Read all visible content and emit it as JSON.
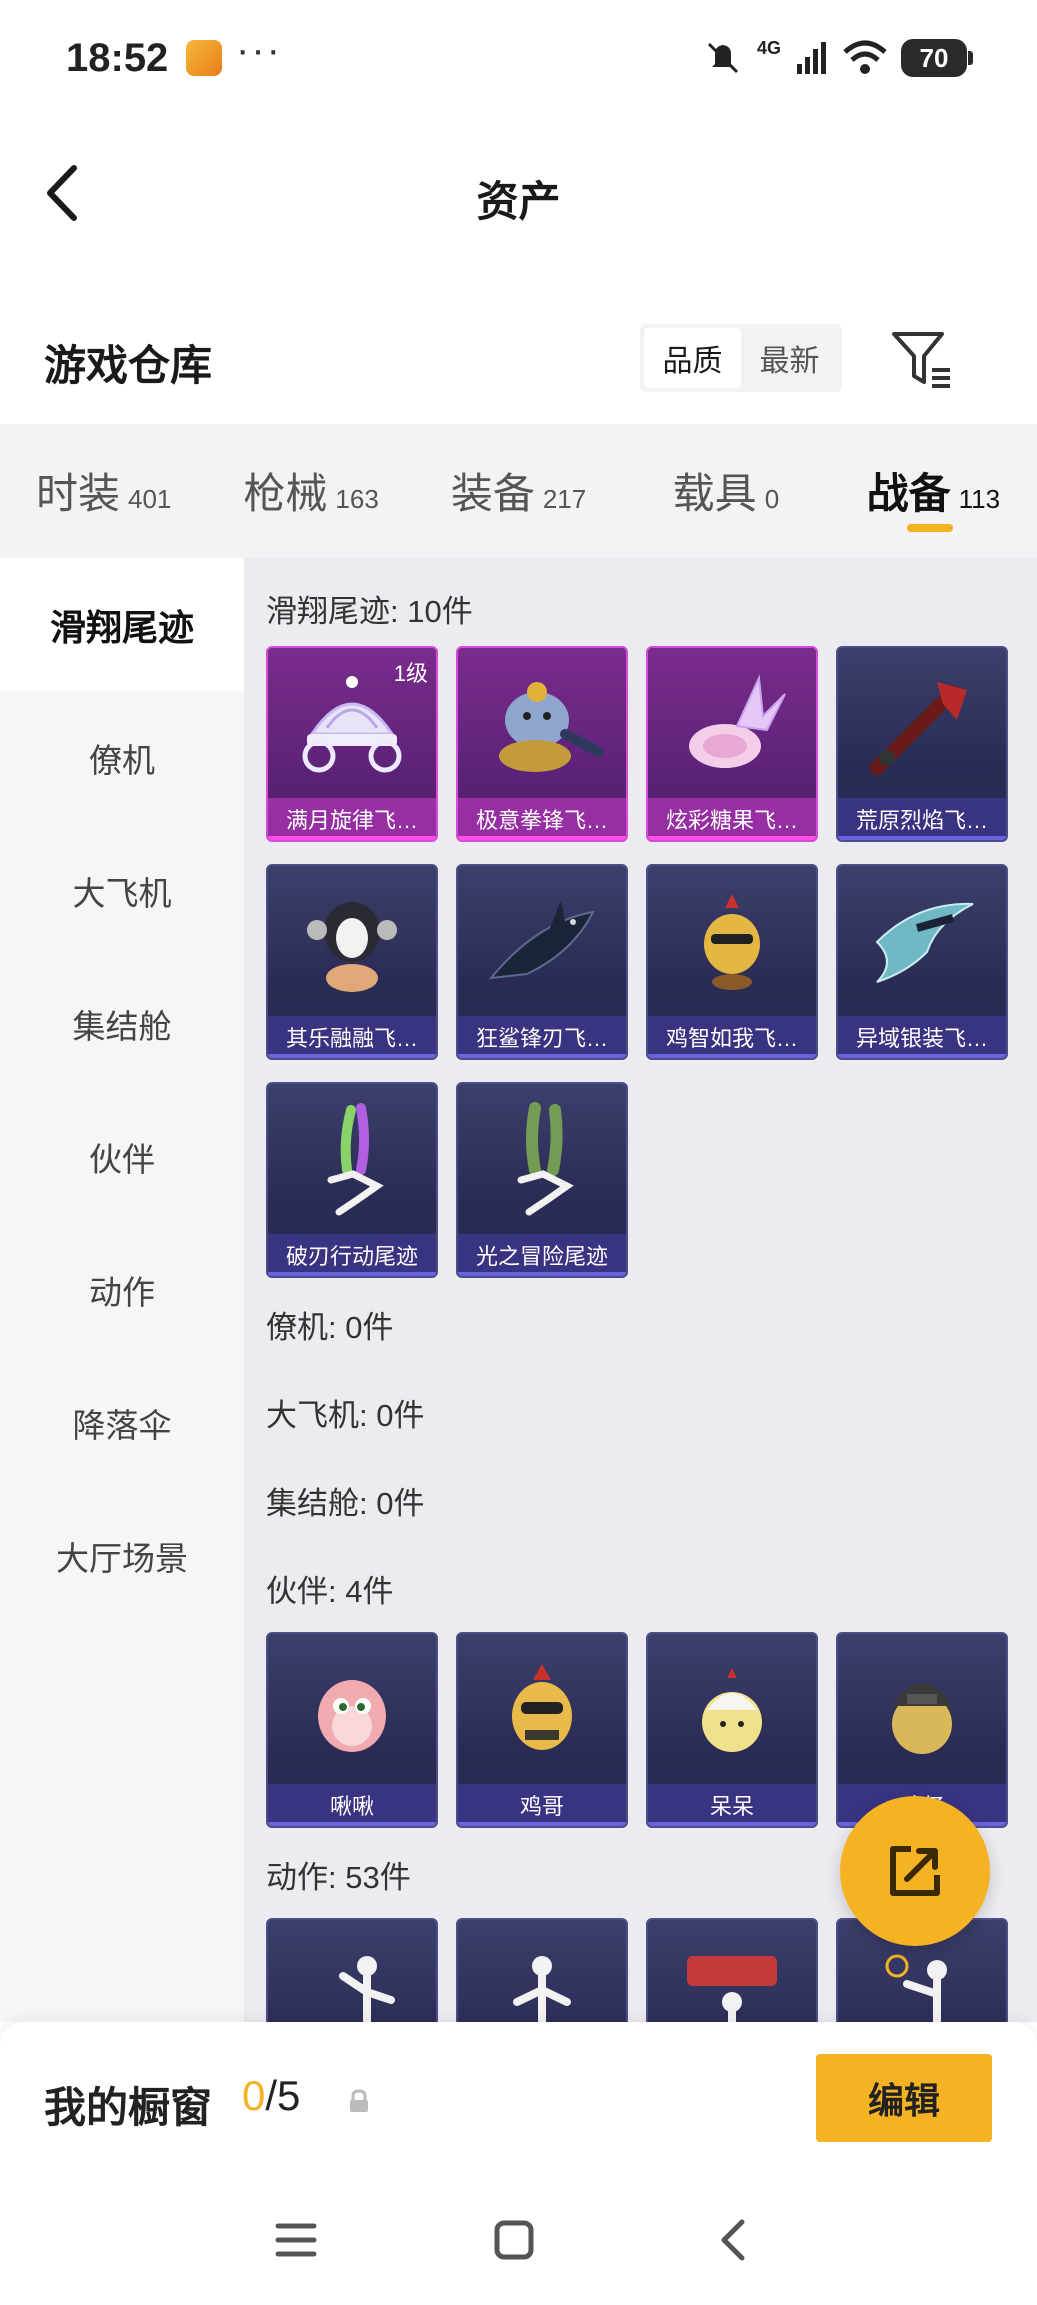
{
  "status_bar": {
    "time": "18:52",
    "more": "···",
    "network": "4G",
    "battery": "70"
  },
  "header": {
    "title": "资产"
  },
  "warehouse": {
    "title": "游戏仓库",
    "sort_options": [
      "品质",
      "最新"
    ],
    "active_sort": "品质"
  },
  "tabs": [
    {
      "label": "时装",
      "count": "401"
    },
    {
      "label": "枪械",
      "count": "163"
    },
    {
      "label": "装备",
      "count": "217"
    },
    {
      "label": "载具",
      "count": "0"
    },
    {
      "label": "战备",
      "count": "113"
    }
  ],
  "active_tab": "战备",
  "sidebar": {
    "items": [
      {
        "label": "滑翔尾迹"
      },
      {
        "label": "僚机"
      },
      {
        "label": "大飞机"
      },
      {
        "label": "集结舱"
      },
      {
        "label": "伙伴"
      },
      {
        "label": "动作"
      },
      {
        "label": "降落伞"
      },
      {
        "label": "大厅场景"
      }
    ],
    "active": "滑翔尾迹"
  },
  "groups": {
    "glide": {
      "title": "滑翔尾迹: 10件",
      "items": [
        {
          "name": "满月旋律飞…",
          "level": "1级",
          "rarity": "purple",
          "icon": "carriage-icon"
        },
        {
          "name": "极意拳锋飞…",
          "rarity": "purple",
          "icon": "elephant-icon"
        },
        {
          "name": "炫彩糖果飞…",
          "rarity": "purple",
          "icon": "candy-icon"
        },
        {
          "name": "荒原烈焰飞…",
          "rarity": "blue",
          "icon": "flame-weapon-icon"
        },
        {
          "name": "其乐融融飞…",
          "rarity": "blue",
          "icon": "penguin-icon"
        },
        {
          "name": "狂鲨锋刃飞…",
          "rarity": "blue",
          "icon": "shark-icon"
        },
        {
          "name": "鸡智如我飞…",
          "rarity": "blue",
          "icon": "chicken-icon"
        },
        {
          "name": "异域银装飞…",
          "rarity": "blue",
          "icon": "blade-icon"
        },
        {
          "name": "破刃行动尾迹",
          "rarity": "blue",
          "icon": "smoke-trail-icon"
        },
        {
          "name": "光之冒险尾迹",
          "rarity": "blue",
          "icon": "smoke-trail-icon"
        }
      ]
    },
    "wingman": {
      "title": "僚机: 0件"
    },
    "plane": {
      "title": "大飞机: 0件"
    },
    "pod": {
      "title": "集结舱: 0件"
    },
    "partner": {
      "title": "伙伴: 4件",
      "items": [
        {
          "name": "啾啾",
          "icon": "pink-bird-icon"
        },
        {
          "name": "鸡哥",
          "icon": "rooster-icon"
        },
        {
          "name": "呆呆",
          "icon": "chick-icon"
        },
        {
          "name": "鸡仔",
          "icon": "helmet-chick-icon"
        }
      ]
    },
    "emote": {
      "title": "动作: 53件"
    }
  },
  "showcase": {
    "label": "我的橱窗",
    "current": "0",
    "separator": "/",
    "max": "5",
    "edit_label": "编辑"
  },
  "colors": {
    "accent": "#f5b323",
    "card_blue": "#2b2c55",
    "card_purple": "#5f237a"
  }
}
